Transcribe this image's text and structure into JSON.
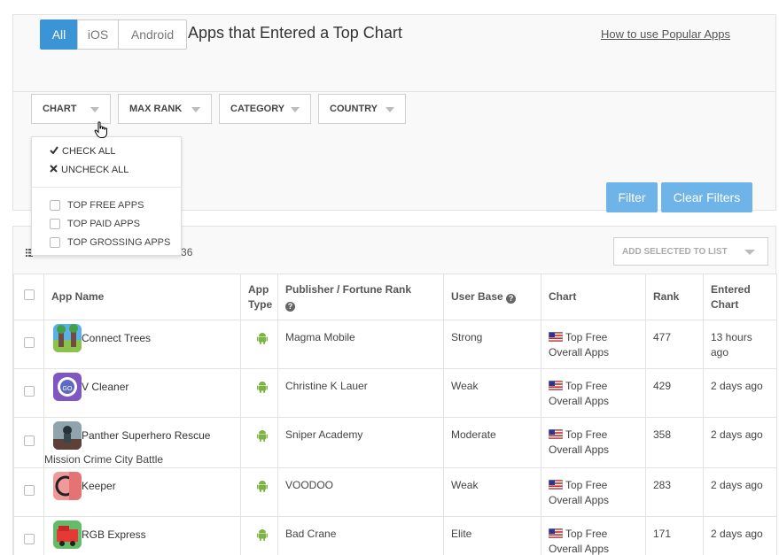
{
  "platform_tabs": [
    {
      "label": "All",
      "active": true
    },
    {
      "label": "iOS",
      "active": false
    },
    {
      "label": "Android",
      "active": false
    }
  ],
  "page_title": "Apps that Entered a Top Chart",
  "help_link": "How to use Popular Apps",
  "filters": {
    "chart": "CHART",
    "max_rank": "MAX RANK",
    "category": "CATEGORY",
    "country": "COUNTRY",
    "filter_button": "Filter",
    "clear_button": "Clear Filters"
  },
  "chart_menu": {
    "check_all": "CHECK ALL",
    "uncheck_all": "UNCHECK ALL",
    "options": [
      "TOP FREE APPS",
      "TOP PAID APPS",
      "TOP GROSSING APPS"
    ]
  },
  "results": {
    "count_text": "of 136",
    "add_to_list": "ADD SELECTED TO LIST"
  },
  "table": {
    "headers": {
      "app_name": "App Name",
      "app_type_1": "App",
      "app_type_2": "Type",
      "publisher": "Publisher / Fortune Rank",
      "user_base": "User Base",
      "chart": "Chart",
      "rank": "Rank",
      "entered_1": "Entered",
      "entered_2": "Chart"
    },
    "rows": [
      {
        "name": "Connect Trees",
        "name2": "",
        "publisher": "Magma Mobile",
        "user_base": "Strong",
        "chart1": "Top Free",
        "chart2": "Overall Apps",
        "rank": "477",
        "entered1": "13 hours",
        "entered2": "ago"
      },
      {
        "name": "V Cleaner",
        "name2": "",
        "publisher": "Christine K Lauer",
        "user_base": "Weak",
        "chart1": "Top Free",
        "chart2": "Overall Apps",
        "rank": "429",
        "entered1": "2 days ago",
        "entered2": ""
      },
      {
        "name": "Panther Superhero Rescue",
        "name2": "Mission Crime City Battle",
        "publisher": "Sniper Academy",
        "user_base": "Moderate",
        "chart1": "Top Free",
        "chart2": "Overall Apps",
        "rank": "358",
        "entered1": "2 days ago",
        "entered2": ""
      },
      {
        "name": "Keeper",
        "name2": "",
        "publisher": "VOODOO",
        "user_base": "Weak",
        "chart1": "Top Free",
        "chart2": "Overall Apps",
        "rank": "283",
        "entered1": "2 days ago",
        "entered2": ""
      },
      {
        "name": "RGB Express",
        "name2": "",
        "publisher": "Bad Crane",
        "user_base": "Elite",
        "chart1": "Top Free",
        "chart2": "Overall Apps",
        "rank": "171",
        "entered1": "2 days ago",
        "entered2": ""
      }
    ]
  },
  "colors": {
    "accent": "#3a94d6",
    "button_light": "#6eb4e8",
    "android_green": "#7cb342"
  }
}
